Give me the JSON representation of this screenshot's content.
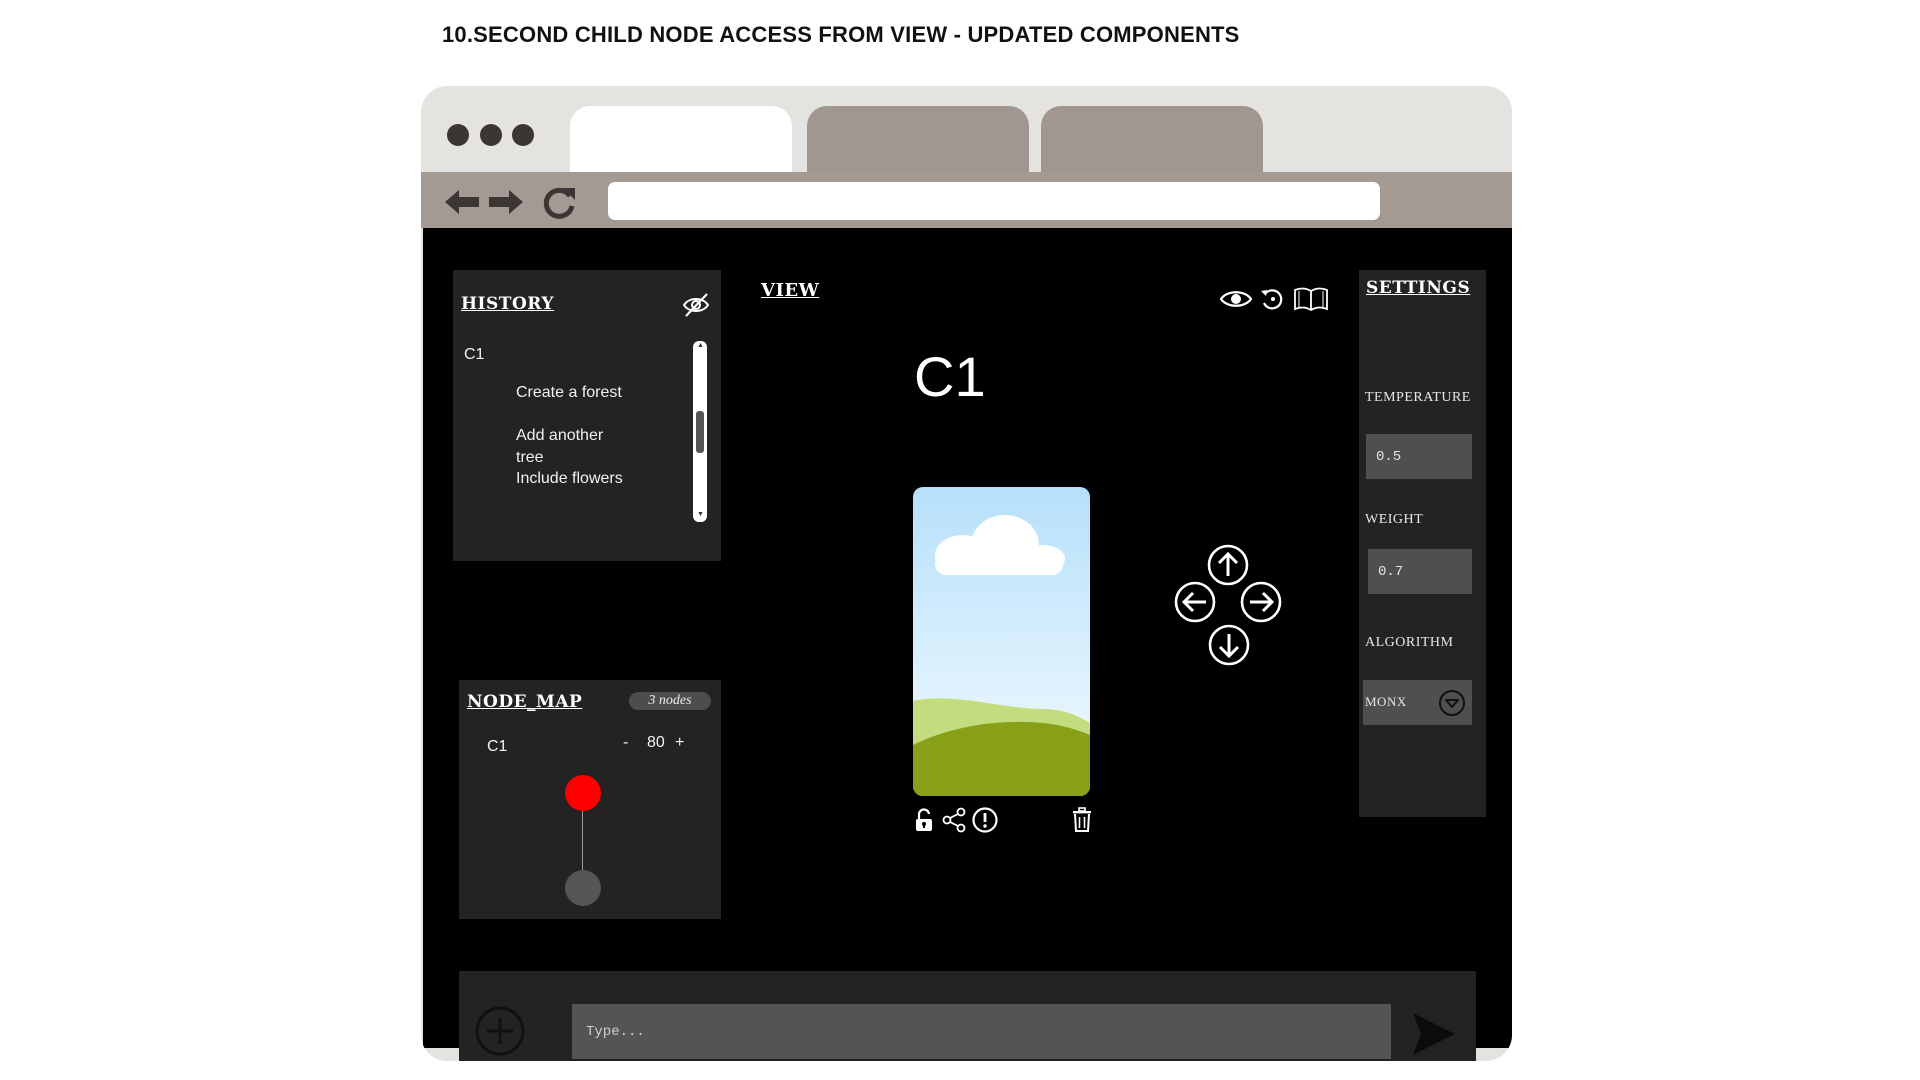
{
  "page": {
    "title": "10.SECOND CHILD NODE ACCESS FROM VIEW  - UPDATED COMPONENTS"
  },
  "browser": {
    "window_dots": [
      "close-dot",
      "minimize-dot",
      "maximize-dot"
    ],
    "tabs": [
      {
        "label": "",
        "active": true
      },
      {
        "label": "",
        "active": false
      },
      {
        "label": "",
        "active": false
      }
    ],
    "url": "",
    "colors": {
      "frame": "#e4e3df",
      "toolbar": "#a39a93",
      "inactive_tab": "#a09790"
    }
  },
  "history": {
    "title": "HISTORY",
    "node": "C1",
    "items": [
      "Create a forest",
      "Add another tree",
      "Include flowers"
    ],
    "toggle_icon": "eye-off-icon"
  },
  "node_map": {
    "title": "NODE_MAP",
    "badge": "3 nodes",
    "node_label": "C1",
    "zoom_minus": "-",
    "zoom_value": "80",
    "zoom_plus": "+",
    "nodes": [
      {
        "state": "active",
        "color": "#ff0000"
      },
      {
        "state": "inactive",
        "color": "#555555"
      }
    ]
  },
  "view": {
    "title": "VIEW",
    "node_title": "C1",
    "header_icons": [
      "eye-icon",
      "history-icon",
      "book-icon"
    ],
    "card_actions": [
      "unlock-icon",
      "share-icon",
      "alert-icon",
      "trash-icon"
    ],
    "direction_controls": [
      "arrow-up-icon",
      "arrow-left-icon",
      "arrow-right-icon",
      "arrow-down-icon"
    ]
  },
  "settings": {
    "title": "SETTINGS",
    "temperature_label": "TEMPERATURE",
    "temperature_value": "0.5",
    "weight_label": "WEIGHT",
    "weight_value": "0.7",
    "algorithm_label": "ALGORITHM",
    "algorithm_value": "MONX"
  },
  "chat": {
    "placeholder": "Type...",
    "add_icon": "plus-circle-icon",
    "send_icon": "send-icon"
  }
}
